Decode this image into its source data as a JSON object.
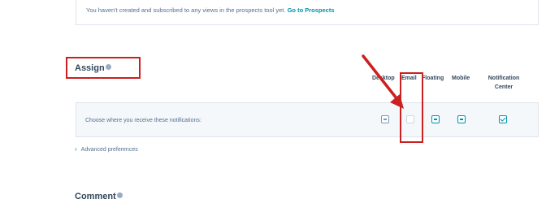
{
  "prospects_notice": {
    "message": "You haven't created and subscribed to any views in the prospects tool yet.",
    "link_label": "Go to Prospects"
  },
  "section": {
    "title": "Assign"
  },
  "columns": {
    "desktop": "Desktop",
    "email": "Email",
    "floating": "Floating",
    "mobile": "Mobile",
    "notification_center_line1": "Notification",
    "notification_center_line2": "Center"
  },
  "row": {
    "label": "Choose where you receive these notifications:",
    "states": {
      "desktop": "indeterminate",
      "email": "unchecked",
      "floating": "indeterminate",
      "mobile": "indeterminate",
      "notification_center": "checked"
    }
  },
  "advanced": {
    "label": "Advanced preferences"
  },
  "next_section": {
    "title": "Comment"
  },
  "colors": {
    "annotation": "#cc1f1f",
    "accent": "#0091ae"
  },
  "annotations": [
    "red-arrow",
    "email-column-highlight",
    "assign-heading-highlight"
  ]
}
